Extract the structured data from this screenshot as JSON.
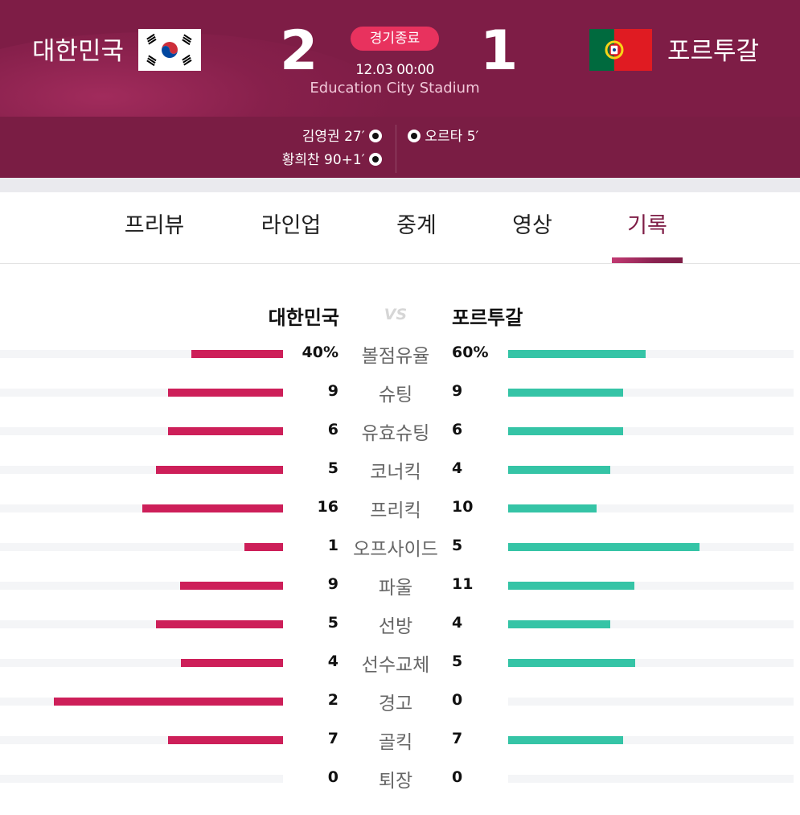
{
  "match": {
    "home_team": "대한민국",
    "away_team": "포르투갈",
    "home_score": "2",
    "away_score": "1",
    "status": "경기종료",
    "datetime": "12.03 00:00",
    "stadium": "Education City Stadium"
  },
  "goals": {
    "home": [
      {
        "text": "김영권 27′"
      },
      {
        "text": "황희찬 90+1′"
      }
    ],
    "away": [
      {
        "text": "오르타 5′"
      }
    ]
  },
  "tabs": [
    {
      "label": "프리뷰",
      "active": false
    },
    {
      "label": "라인업",
      "active": false
    },
    {
      "label": "중계",
      "active": false
    },
    {
      "label": "영상",
      "active": false
    },
    {
      "label": "기록",
      "active": true
    }
  ],
  "stats_header": {
    "home": "대한민국",
    "vs": "VS",
    "away": "포르투갈"
  },
  "colors": {
    "header_bg": "#7e1d46",
    "status_badge": "#e8325e",
    "home_bar": "#cd1f59",
    "away_bar": "#35c4a6",
    "active_tab": "#7e1d46"
  },
  "stats": [
    {
      "label": "볼점유율",
      "home": "40%",
      "away": "60%",
      "home_value": 40,
      "away_value": 60
    },
    {
      "label": "슈팅",
      "home": "9",
      "away": "9",
      "home_value": 9,
      "away_value": 9
    },
    {
      "label": "유효슈팅",
      "home": "6",
      "away": "6",
      "home_value": 6,
      "away_value": 6
    },
    {
      "label": "코너킥",
      "home": "5",
      "away": "4",
      "home_value": 5,
      "away_value": 4
    },
    {
      "label": "프리킥",
      "home": "16",
      "away": "10",
      "home_value": 16,
      "away_value": 10
    },
    {
      "label": "오프사이드",
      "home": "1",
      "away": "5",
      "home_value": 1,
      "away_value": 5
    },
    {
      "label": "파울",
      "home": "9",
      "away": "11",
      "home_value": 9,
      "away_value": 11
    },
    {
      "label": "선방",
      "home": "5",
      "away": "4",
      "home_value": 5,
      "away_value": 4
    },
    {
      "label": "선수교체",
      "home": "4",
      "away": "5",
      "home_value": 4,
      "away_value": 5
    },
    {
      "label": "경고",
      "home": "2",
      "away": "0",
      "home_value": 2,
      "away_value": 0
    },
    {
      "label": "골킥",
      "home": "7",
      "away": "7",
      "home_value": 7,
      "away_value": 7
    },
    {
      "label": "퇴장",
      "home": "0",
      "away": "0",
      "home_value": 0,
      "away_value": 0
    }
  ]
}
